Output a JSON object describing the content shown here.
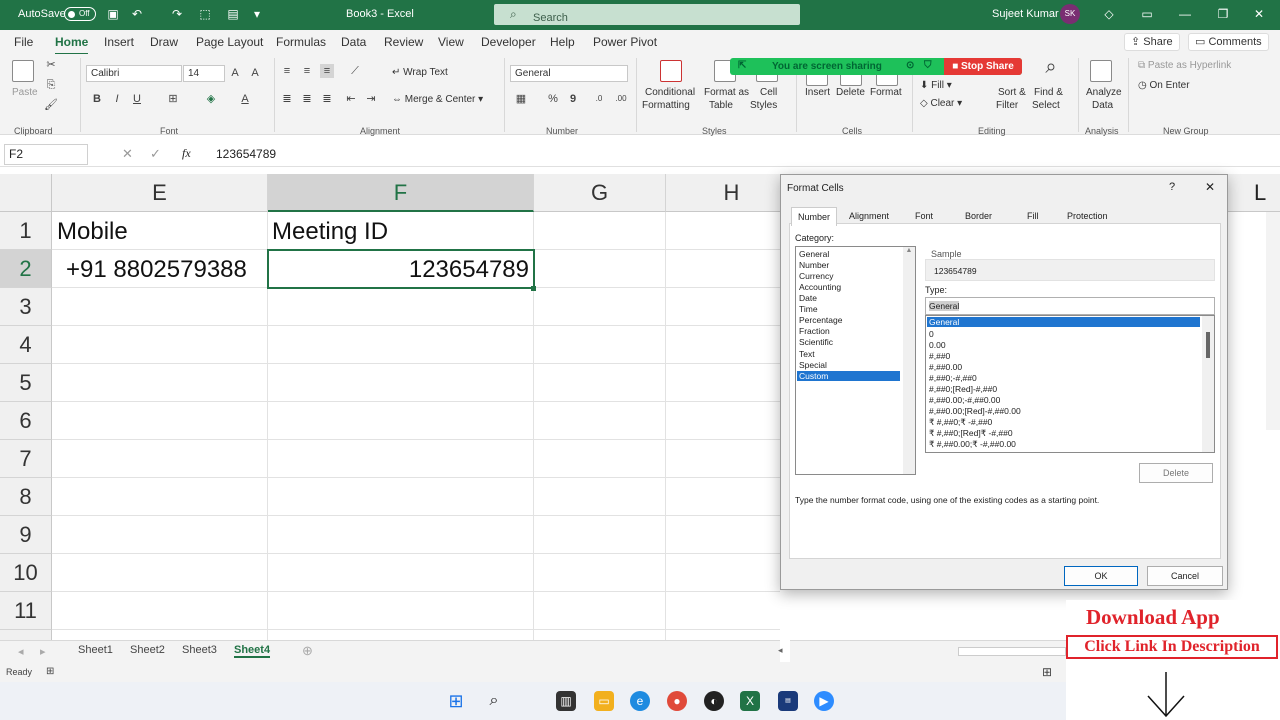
{
  "titlebar": {
    "autosave": "AutoSave",
    "autosave_state": "Off",
    "doc_title": "Book3 - Excel",
    "search_placeholder": "Search",
    "user": "Sujeet Kumar",
    "initials": "SK"
  },
  "menu": {
    "items": [
      "File",
      "Home",
      "Insert",
      "Draw",
      "Page Layout",
      "Formulas",
      "Data",
      "Review",
      "View",
      "Developer",
      "Help",
      "Power Pivot"
    ],
    "active": "Home",
    "share": "Share",
    "comments": "Comments"
  },
  "ribbon": {
    "font_name": "Calibri",
    "font_size": "14",
    "number_format": "General",
    "wrap_text": "Wrap Text",
    "merge_center": "Merge & Center",
    "conditional_formatting": [
      "Conditional",
      "Formatting"
    ],
    "format_as_table": [
      "Format as",
      "Table"
    ],
    "cell_styles": [
      "Cell",
      "Styles"
    ],
    "insert": "Insert",
    "delete": "Delete",
    "format": "Format",
    "fill": "Fill",
    "clear": "Clear",
    "sort_filter": [
      "Sort &",
      "Filter"
    ],
    "find_select": [
      "Find &",
      "Select"
    ],
    "analyze_data": [
      "Analyze",
      "Data"
    ],
    "paste_hyperlink": "Paste as Hyperlink",
    "on_enter": "On Enter",
    "paste": "Paste",
    "groups": {
      "clipboard": "Clipboard",
      "font": "Font",
      "alignment": "Alignment",
      "number": "Number",
      "styles": "Styles",
      "cells": "Cells",
      "editing": "Editing",
      "analysis": "Analysis",
      "new_group": "New Group"
    }
  },
  "screen_share": {
    "message": "You are screen sharing",
    "stop": "Stop Share"
  },
  "formula_bar": {
    "name_box": "F2",
    "fx": "fx",
    "formula": "123654789"
  },
  "sheet": {
    "columns": [
      "E",
      "F",
      "G",
      "H"
    ],
    "rows": [
      "1",
      "2",
      "3",
      "4",
      "5",
      "6",
      "7",
      "8",
      "9",
      "10",
      "11"
    ],
    "cells": {
      "E1": "Mobile",
      "F1": "Meeting ID",
      "E2": "+91 8802579388",
      "F2": "123654789"
    },
    "partial_column": "L"
  },
  "sheet_tabs": {
    "tabs": [
      "Sheet1",
      "Sheet2",
      "Sheet3",
      "Sheet4"
    ],
    "active": "Sheet4"
  },
  "status": {
    "text": "Ready"
  },
  "dialog": {
    "title": "Format Cells",
    "help": "?",
    "close": "✕",
    "tabs": [
      "Number",
      "Alignment",
      "Font",
      "Border",
      "Fill",
      "Protection"
    ],
    "active_tab": "Number",
    "category_label": "Category:",
    "categories": [
      "General",
      "Number",
      "Currency",
      "Accounting",
      "Date",
      "Time",
      "Percentage",
      "Fraction",
      "Scientific",
      "Text",
      "Special",
      "Custom"
    ],
    "selected_category": "Custom",
    "sample_label": "Sample",
    "sample_value": "123654789",
    "type_label": "Type:",
    "type_value": "General",
    "formats": [
      "General",
      "0",
      "0.00",
      "#,##0",
      "#,##0.00",
      "#,##0;-#,##0",
      "#,##0;[Red]-#,##0",
      "#,##0.00;-#,##0.00",
      "#,##0.00;[Red]-#,##0.00",
      "₹ #,##0;₹ -#,##0",
      "₹ #,##0;[Red]₹ -#,##0",
      "₹ #,##0.00;₹ -#,##0.00"
    ],
    "selected_format": "General",
    "delete_button": "Delete",
    "hint": "Type the number format code, using one of the existing codes as a starting point.",
    "ok": "OK",
    "cancel": "Cancel"
  },
  "promo": {
    "line1": "Download App",
    "line2": "Click Link In Description"
  },
  "colors": {
    "excel_green": "#217346",
    "selection_blue": "#1f75d0",
    "promo_red": "#e0232b",
    "share_green": "#1ec15a",
    "stop_red": "#e53935"
  }
}
